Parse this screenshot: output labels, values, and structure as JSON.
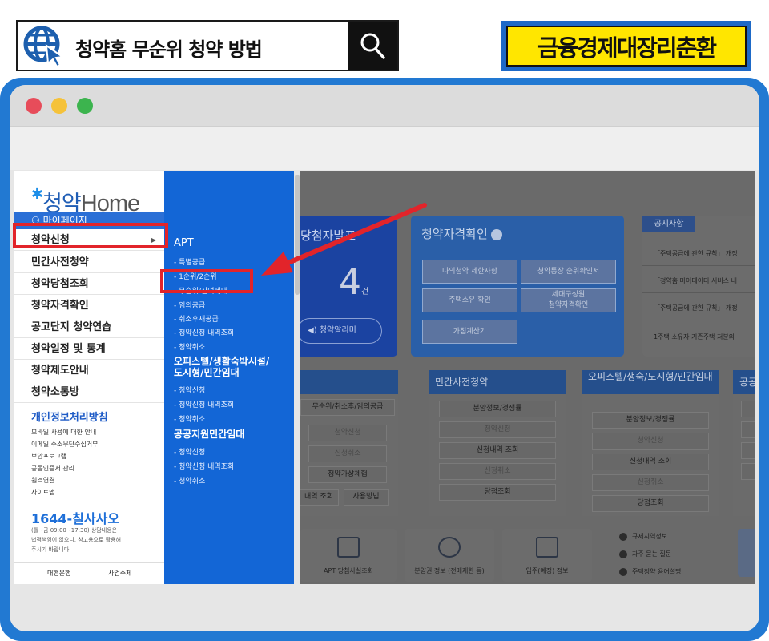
{
  "header": {
    "search_text": "청약홈 무순위 청약 방법",
    "brand": "금융경제대장리춘환"
  },
  "browser": {
    "colors": {
      "frame": "#2279d2",
      "close": "#e74c5a",
      "minimize": "#f5c23a",
      "maximize": "#3cb44e"
    }
  },
  "sidebar": {
    "logo_prefix": "청약",
    "logo_home": "Home",
    "mypage": "마이페이지",
    "items": [
      "청약신청",
      "민간사전청약",
      "청약당첨조회",
      "청약자격확인",
      "공고단지 청약연습",
      "청약일정 및 통계",
      "청약제도안내",
      "청약소통방"
    ],
    "links_title": "개인정보처리방침",
    "links": [
      "모바일 사용에 대한 안내",
      "이메일 주소무단수집거부",
      "보안프로그램",
      "공동인증서 관리",
      "원격연결",
      "사이트맵"
    ],
    "phone": "1644-칠사사오",
    "phone_notes": [
      "(월~금 09:00~17:30) 상담내용은",
      "법적책임이 없으니, 참고용으로 활용해",
      "주시기 바랍니다."
    ],
    "footer": [
      "대행은행",
      "사업주체"
    ]
  },
  "submenu": {
    "apt_title": "APT",
    "apt_items": [
      "- 특별공급",
      "- 1순위/2순위",
      "- 무순위/잔여세대",
      "- 임의공급",
      "- 취소후재공급",
      "- 청약신청 내역조회",
      "- 청약취소"
    ],
    "officetel_title_1": "오피스텔/생활숙박시설/",
    "officetel_title_2": "도시형/민간임대",
    "officetel_items": [
      "- 청약신청",
      "- 청약신청 내역조회",
      "- 청약취소"
    ],
    "public_title": "공공지원민간임대",
    "public_items": [
      "- 청약신청",
      "- 청약신청 내역조회",
      "- 청약취소"
    ]
  },
  "main": {
    "winner_title": "당첨자발표",
    "winner_count": "4",
    "winner_unit": "건",
    "winner_alarm": "청약알리미",
    "qual_title": "청약자격확인",
    "qual_buttons": [
      "나의청약 제한사항",
      "청약통장 순위확인서",
      "주택소유 확인",
      "세대구성원\n청약자격확인",
      "가점계산기"
    ],
    "notice_tab": "공지사항",
    "notices": [
      "「주택공급에 관한 규칙」 개정",
      "「청약홈 마이데이터 서비스 내",
      "「주택공급에 관한 규칙」 개정",
      "1주택 소유자 기존주택 처분의"
    ],
    "section_apt_items": [
      "무순위/취소후/임의공급",
      "청약신청",
      "신청취소",
      "청약가상체험",
      "내역 조회",
      "사용방법"
    ],
    "section_private_title": "민간사전청약",
    "section_private_items": [
      "분양정보/경쟁률",
      "청약신청",
      "신청내역 조회",
      "신청취소",
      "당첨조회"
    ],
    "section_officetel_title": "오피스텔/생숙/도시형/민간임대",
    "section_officetel_items": [
      "분양정보/경쟁률",
      "청약신청",
      "신청내역 조회",
      "신청취소",
      "당첨조회"
    ],
    "section_public_title": "공공지",
    "bottom_cards": [
      "APT 당첨사실조회",
      "분양권 정보 (전매제한 등)",
      "입주(예정) 정보"
    ],
    "quick_links": [
      "규제지역정보",
      "자주 묻는 질문",
      "주택청약 용어설명"
    ]
  }
}
